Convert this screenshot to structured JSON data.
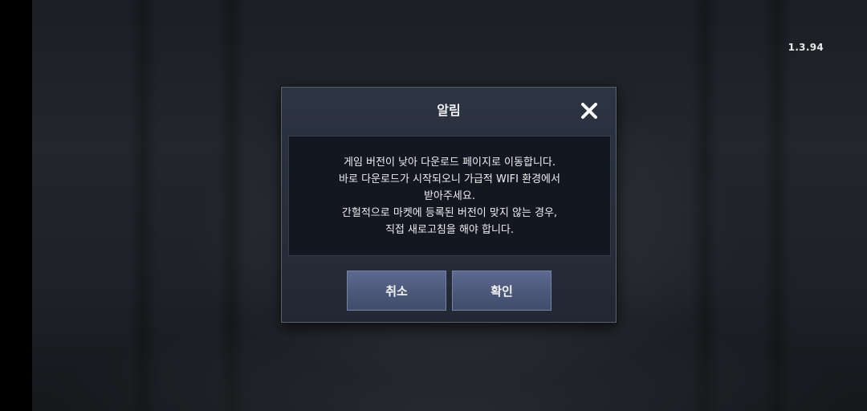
{
  "version": "1.3.94",
  "dialog": {
    "title": "알림",
    "message_lines": [
      "게임 버전이 낮아 다운로드 페이지로 이동합니다.",
      "바로 다운로드가 시작되오니 가급적 WIFI 환경에서",
      "받아주세요.",
      "간헐적으로 마켓에 등록된 버전이 맞지 않는 경우,",
      "직접 새로고침을 해야 합니다."
    ],
    "cancel_label": "취소",
    "confirm_label": "확인",
    "close_icon": "close-icon"
  },
  "colors": {
    "dialog_bg": "#2d3442",
    "message_bg": "#121722",
    "button_bg": "#4b5879",
    "text": "#eeeeee"
  }
}
